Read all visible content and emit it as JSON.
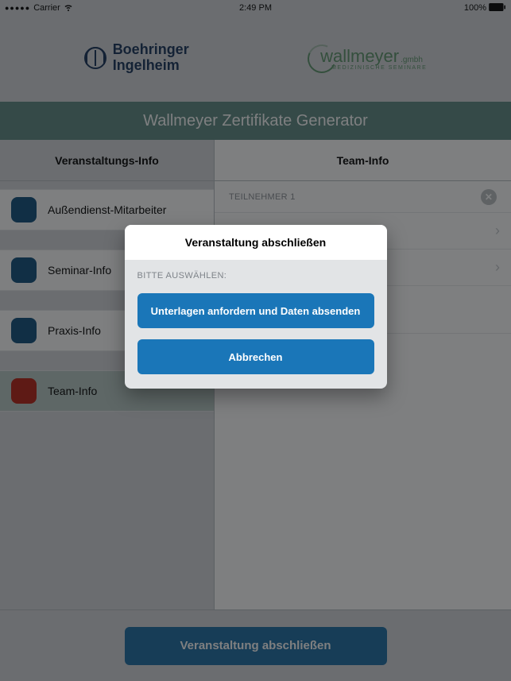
{
  "status": {
    "carrier": "Carrier",
    "time": "2:49 PM",
    "battery": "100%"
  },
  "brand1": {
    "line1": "Boehringer",
    "line2": "Ingelheim"
  },
  "brand2": {
    "name": "wallmeyer",
    "suffix": ".gmbh",
    "sub": "MEDIZINISCHE  SEMINARE"
  },
  "banner": {
    "title": "Wallmeyer Zertifikate Generator"
  },
  "tabs": {
    "left": "Veranstaltungs-Info",
    "right": "Team-Info"
  },
  "sidebar": {
    "items": [
      {
        "label": "Außendienst-Mitarbeiter",
        "color": "blue"
      },
      {
        "label": "Seminar-Info",
        "color": "blue"
      },
      {
        "label": "Praxis-Info",
        "color": "blue"
      },
      {
        "label": "Team-Info",
        "color": "red",
        "selected": true
      }
    ]
  },
  "detail": {
    "section_label": "TEILNEHMER 1"
  },
  "bottom_button": "Veranstaltung abschließen",
  "dialog": {
    "title": "Veranstaltung abschließen",
    "subtitle": "BITTE AUSWÄHLEN:",
    "primary": "Unterlagen anfordern und Daten absenden",
    "secondary": "Abbrechen"
  }
}
